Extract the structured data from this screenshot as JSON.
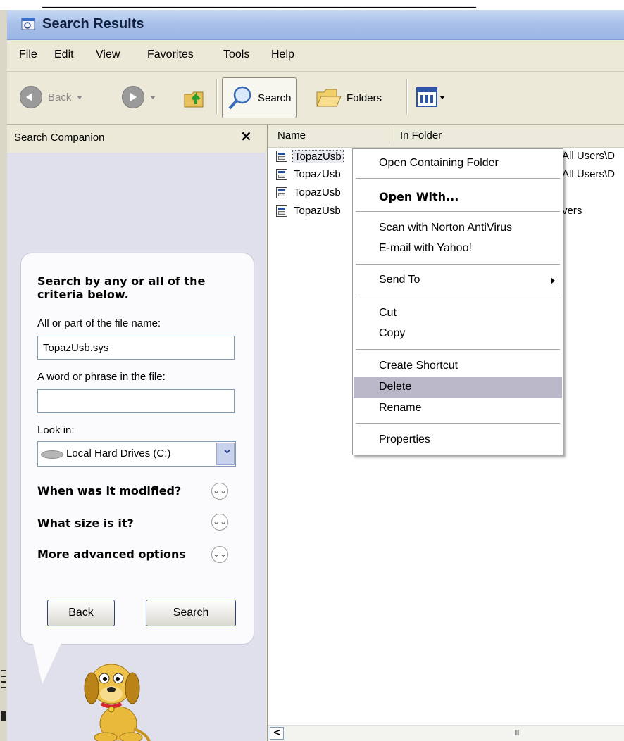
{
  "window": {
    "title": "Search Results"
  },
  "menu": [
    "File",
    "Edit",
    "View",
    "Favorites",
    "Tools",
    "Help"
  ],
  "toolbar": {
    "back_label": "Back",
    "search_label": "Search",
    "folders_label": "Folders"
  },
  "companion": {
    "title": "Search Companion",
    "close": "×",
    "heading": "Search by any or all of the criteria below.",
    "file_name_label": "All or part of the file name:",
    "file_name_value": "TopazUsb.sys",
    "phrase_label": "A word or phrase in the file:",
    "phrase_value": "",
    "look_in_label": "Look in:",
    "look_in_value": "Local Hard Drives (C:)",
    "options": [
      "When was it modified?",
      "What size is it?",
      "More advanced options"
    ],
    "back_button": "Back",
    "search_button": "Search"
  },
  "results": {
    "columns": [
      "Name",
      "In Folder"
    ],
    "rows": [
      {
        "name": "TopazUsb",
        "folder": "All Users\\D"
      },
      {
        "name": "TopazUsb",
        "folder": "All Users\\D"
      },
      {
        "name": "TopazUsb",
        "folder": ""
      },
      {
        "name": "TopazUsb",
        "folder": "vers"
      }
    ]
  },
  "context_menu": {
    "open_containing": "Open Containing Folder",
    "open_with": "Open With...",
    "scan": "Scan with Norton AntiVirus",
    "email": "E-mail with Yahoo!",
    "send_to": "Send To",
    "cut": "Cut",
    "copy": "Copy",
    "create_shortcut": "Create Shortcut",
    "delete": "Delete",
    "rename": "Rename",
    "properties": "Properties"
  },
  "scroll_thumb": "III",
  "colors": {
    "titlebar": "#a9c1ea",
    "companion_bg": "#e0e0ec",
    "menu_highlight": "#b9b7c8"
  }
}
